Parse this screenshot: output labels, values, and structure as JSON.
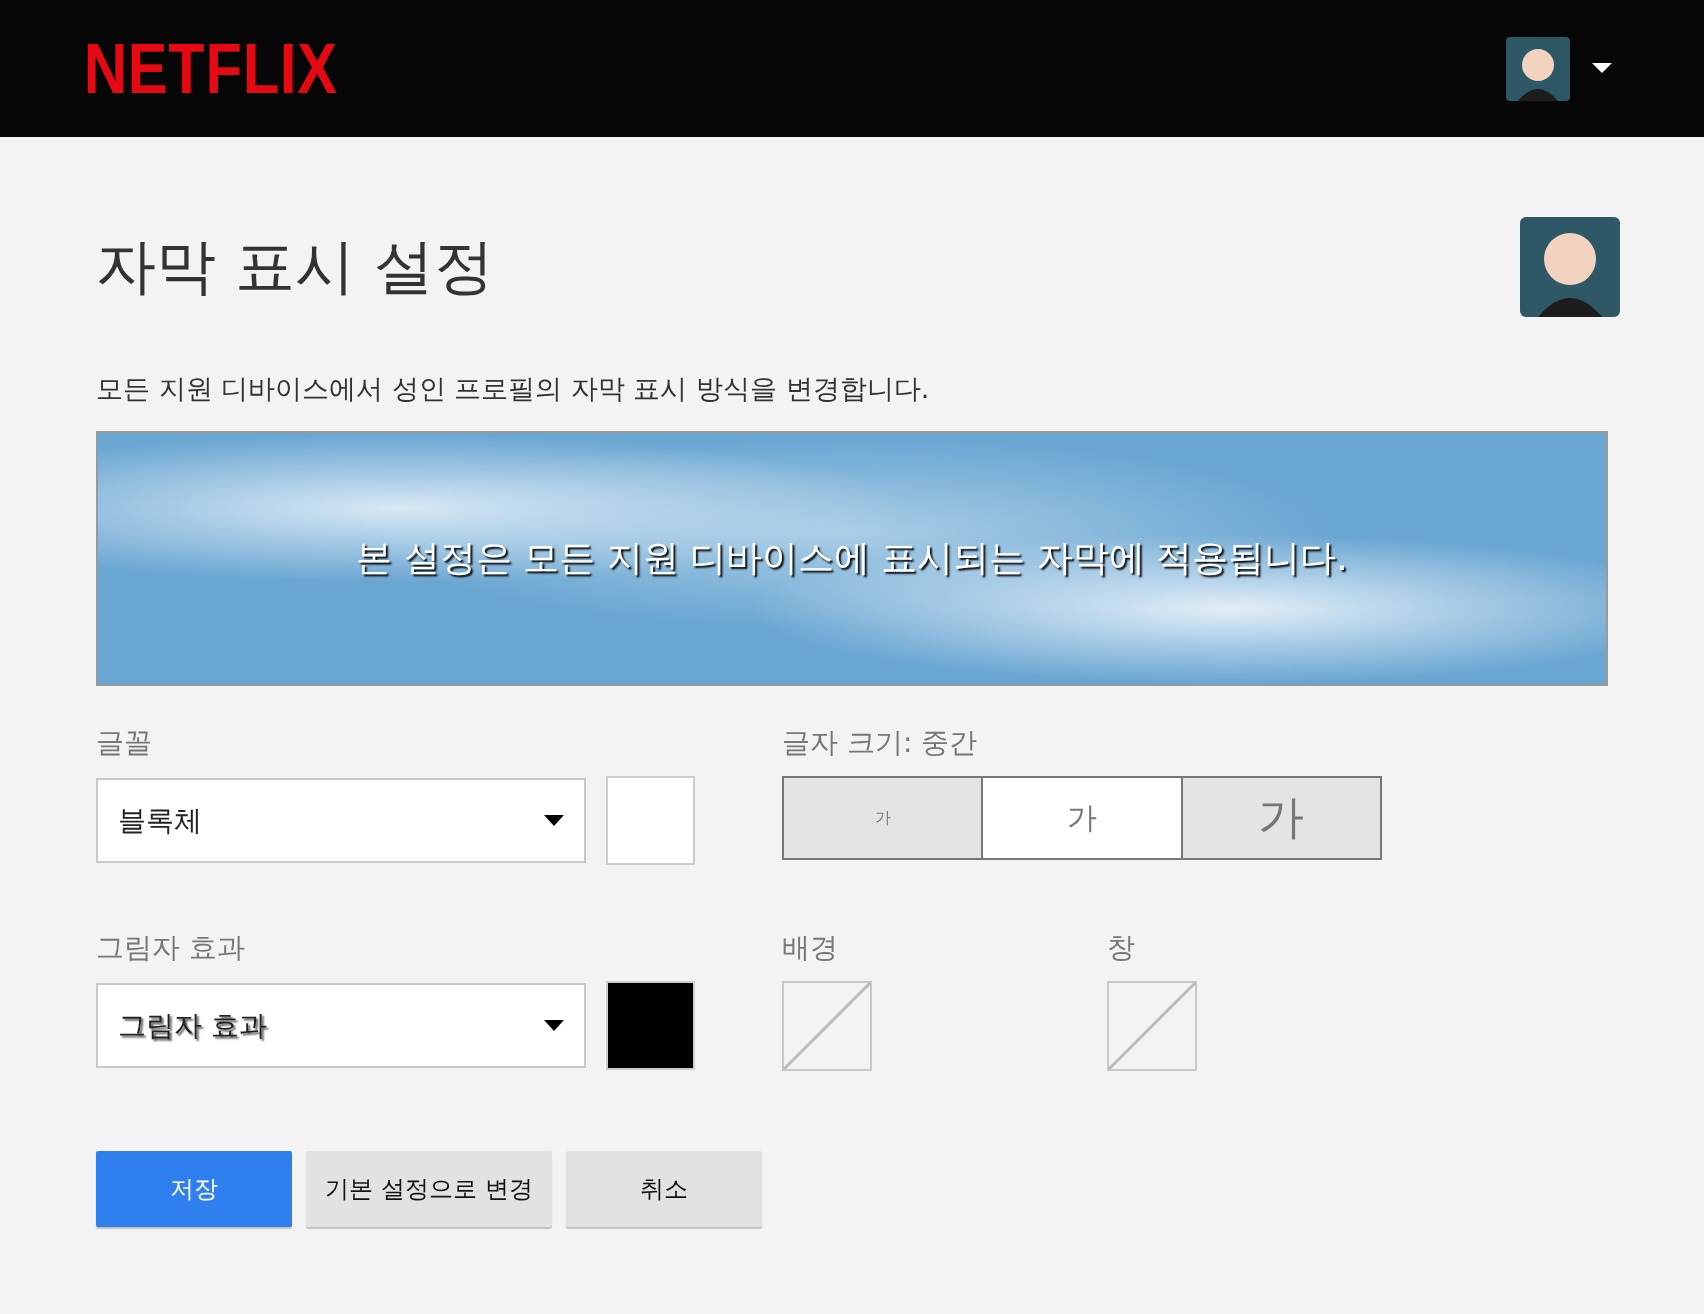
{
  "header": {
    "logo": "NETFLIX"
  },
  "title": "자막 표시 설정",
  "description": "모든 지원 디바이스에서 성인 프로필의 자막 표시 방식을 변경합니다.",
  "preview": {
    "caption": "본 설정은 모든 지원 디바이스에 표시되는 자막에 적용됩니다."
  },
  "font": {
    "label": "글꼴",
    "value": "블록체",
    "color": "#ffffff"
  },
  "text_size": {
    "label": "글자 크기: 중간",
    "options": [
      {
        "label": "가",
        "selected": false
      },
      {
        "label": "가",
        "selected": true
      },
      {
        "label": "가",
        "selected": false
      }
    ]
  },
  "shadow": {
    "label": "그림자 효과",
    "value": "그림자 효과",
    "color": "#000000"
  },
  "background": {
    "label": "배경"
  },
  "window": {
    "label": "창"
  },
  "buttons": [
    {
      "label": "저장",
      "kind": "primary"
    },
    {
      "label": "기본 설정으로 변경",
      "kind": "secondary"
    },
    {
      "label": "취소",
      "kind": "secondary"
    }
  ]
}
